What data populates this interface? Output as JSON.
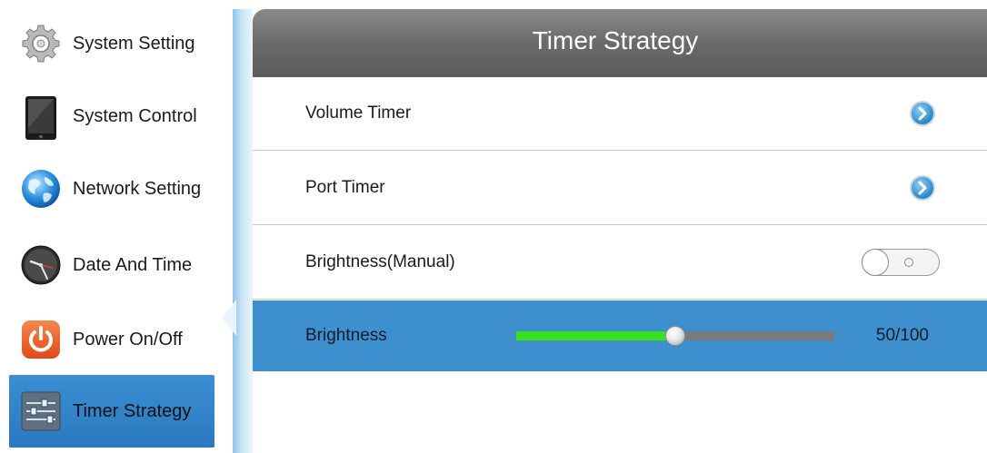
{
  "sidebar": {
    "items": [
      {
        "label": "System Setting",
        "icon": "gear-icon",
        "active": false
      },
      {
        "label": "System Control",
        "icon": "tablet-icon",
        "active": false
      },
      {
        "label": "Network Setting",
        "icon": "globe-icon",
        "active": false
      },
      {
        "label": "Date And Time",
        "icon": "clock-icon",
        "active": false
      },
      {
        "label": "Power On/Off",
        "icon": "power-icon",
        "active": false
      },
      {
        "label": "Timer Strategy",
        "icon": "sliders-icon",
        "active": true
      }
    ]
  },
  "main": {
    "title": "Timer Strategy",
    "rows": [
      {
        "label": "Volume Timer",
        "control": "chevron"
      },
      {
        "label": "Port Timer",
        "control": "chevron"
      },
      {
        "label": "Brightness(Manual)",
        "control": "toggle",
        "toggle_on": false
      },
      {
        "label": "Brightness",
        "control": "slider",
        "value_text": "50/100",
        "value": 50,
        "max": 100
      }
    ]
  },
  "colors": {
    "active_item": "#2f82c8",
    "selected_row": "#3d8fce",
    "header": "#6d6d6d",
    "slider_fill": "#39e11d",
    "chevron": "#2f8fd0"
  }
}
